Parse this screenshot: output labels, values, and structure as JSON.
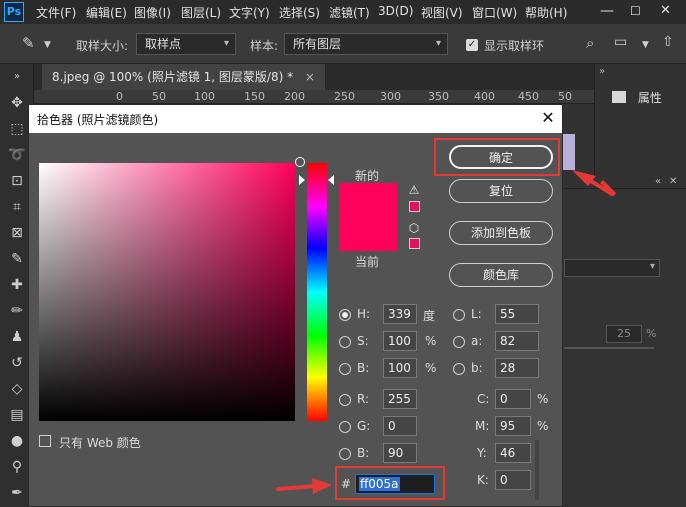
{
  "menubar": {
    "logo": "Ps",
    "items": [
      "文件(F)",
      "编辑(E)",
      "图像(I)",
      "图层(L)",
      "文字(Y)",
      "选择(S)",
      "滤镜(T)",
      "3D(D)",
      "视图(V)",
      "窗口(W)",
      "帮助(H)"
    ]
  },
  "options_bar": {
    "sample_size_label": "取样大小:",
    "sample_size_value": "取样点",
    "sample_label": "样本:",
    "sample_value": "所有图层",
    "show_ring_label": "显示取样环"
  },
  "document": {
    "tab_label": "8.jpeg @ 100% (照片滤镜 1, 图层蒙版/8) *",
    "tab_close": "×",
    "ruler_ticks": [
      "0",
      "50",
      "100",
      "150",
      "200",
      "250",
      "300",
      "350",
      "400",
      "450",
      "50"
    ]
  },
  "right_panel": {
    "properties_label": "属性",
    "value_25": "25",
    "percent": "%"
  },
  "color_picker": {
    "title": "拾色器 (照片滤镜颜色)",
    "close": "✕",
    "new_label": "新的",
    "current_label": "当前",
    "new_color": "#ff005a",
    "current_color": "#ff005a",
    "buttons": {
      "ok": "确定",
      "reset": "复位",
      "add_to_swatches": "添加到色板",
      "color_libraries": "颜色库"
    },
    "hsb": {
      "h_label": "H:",
      "h_value": "339",
      "h_unit": "度",
      "s_label": "S:",
      "s_value": "100",
      "s_unit": "%",
      "b_label": "B:",
      "b_value": "100",
      "b_unit": "%"
    },
    "rgb": {
      "r_label": "R:",
      "r_value": "255",
      "g_label": "G:",
      "g_value": "0",
      "b_label": "B:",
      "b_value": "90"
    },
    "lab": {
      "l_label": "L:",
      "l_value": "55",
      "a_label": "a:",
      "a_value": "82",
      "b_label": "b:",
      "b_value": "28"
    },
    "cmyk": {
      "c_label": "C:",
      "c_value": "0",
      "c_unit": "%",
      "m_label": "M:",
      "m_value": "95",
      "m_unit": "%",
      "y_label": "Y:",
      "y_value": "46",
      "k_label": "K:",
      "k_value": "0"
    },
    "hex_label": "#",
    "hex_value": "ff005a",
    "web_only_label": "只有 Web 颜色"
  },
  "annotation_color": "#e53935"
}
